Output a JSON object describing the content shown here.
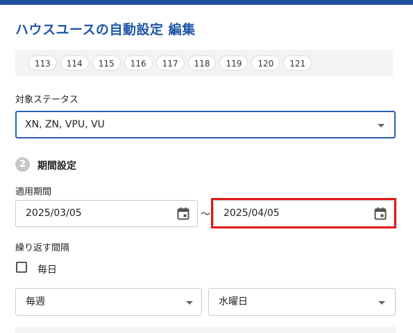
{
  "header": {
    "title": "ハウスユースの自動設定 編集"
  },
  "chips": [
    "113",
    "114",
    "115",
    "116",
    "117",
    "118",
    "119",
    "120",
    "121"
  ],
  "status": {
    "label": "対象ステータス",
    "value": "XN, ZN, VPU, VU"
  },
  "period_section": {
    "step_number": "2",
    "title": "期間設定",
    "range_label": "適用期間",
    "start_date": "2025/03/05",
    "separator": "～",
    "end_date": "2025/04/05"
  },
  "repeat": {
    "label": "繰り返す間隔",
    "daily_label": "毎日",
    "daily_checked": false,
    "frequency_value": "毎週",
    "weekday_value": "水曜日"
  },
  "colors": {
    "accent": "#1f56a8",
    "highlight": "#e01818"
  }
}
